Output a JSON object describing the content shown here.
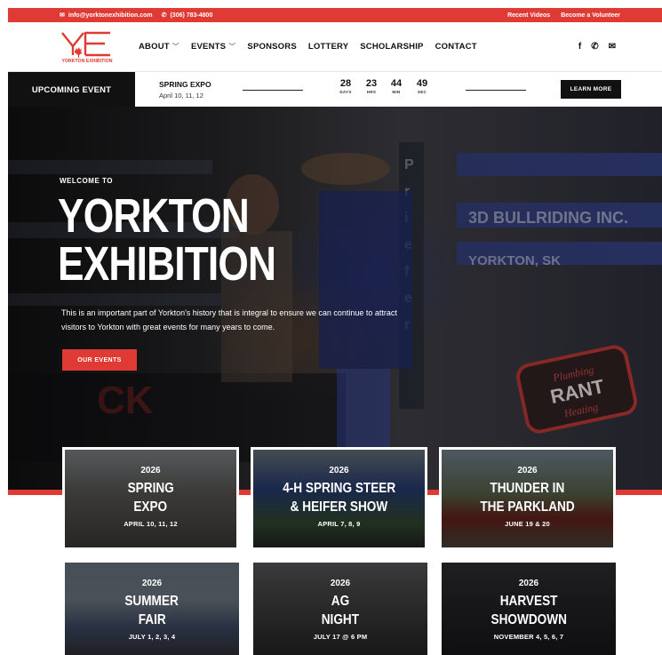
{
  "topbar": {
    "email": "info@yorktonexhibition.com",
    "phone": "(306) 783-4800",
    "links": [
      "Recent Videos",
      "Become a Volunteer"
    ]
  },
  "logo": {
    "letters": "YE",
    "text": "YORKTON EXHIBITION"
  },
  "nav": {
    "items": [
      {
        "label": "ABOUT",
        "caret": true
      },
      {
        "label": "EVENTS",
        "caret": true
      },
      {
        "label": "SPONSORS",
        "caret": false
      },
      {
        "label": "LOTTERY",
        "caret": false
      },
      {
        "label": "SCHOLARSHIP",
        "caret": false
      },
      {
        "label": "CONTACT",
        "caret": false
      }
    ]
  },
  "social": [
    "facebook-icon",
    "phone-icon",
    "envelope-icon"
  ],
  "event_bar": {
    "label": "UPCOMING EVENT",
    "event_name": "SPRING EXPO",
    "event_date": "April 10, 11, 12",
    "countdown": [
      {
        "value": "28",
        "unit": "DAYS"
      },
      {
        "value": "23",
        "unit": "HRS"
      },
      {
        "value": "44",
        "unit": "MIN"
      },
      {
        "value": "49",
        "unit": "SEC"
      }
    ],
    "button": "LEARN MORE"
  },
  "hero": {
    "welcome": "WELCOME TO",
    "title_line1": "YORKTON",
    "title_line2": "EXHIBITION",
    "description": "This is an important part of Yorkton's history that is integral to ensure we can continue to attract visitors to Yorkton with great events for many years to come.",
    "button": "OUR EVENTS"
  },
  "cards": [
    {
      "year": "2026",
      "name_line1": "SPRING",
      "name_line2": "EXPO",
      "date": "APRIL 10, 11, 12"
    },
    {
      "year": "2026",
      "name_line1": "4-H SPRING STEER",
      "name_line2": "& HEIFER SHOW",
      "date": "APRIL 7, 8, 9"
    },
    {
      "year": "2026",
      "name_line1": "THUNDER IN",
      "name_line2": "THE PARKLAND",
      "date": "JUNE 19 & 20"
    },
    {
      "year": "2026",
      "name_line1": "SUMMER",
      "name_line2": "FAIR",
      "date": "JULY 1, 2, 3, 4"
    },
    {
      "year": "2026",
      "name_line1": "AG",
      "name_line2": "NIGHT",
      "date": "JULY 17 @ 6 PM"
    },
    {
      "year": "2026",
      "name_line1": "HARVEST",
      "name_line2": "SHOWDOWN",
      "date": "NOVEMBER 4, 5, 6, 7"
    }
  ],
  "colors": {
    "accent": "#e03a34",
    "dark": "#111111"
  }
}
